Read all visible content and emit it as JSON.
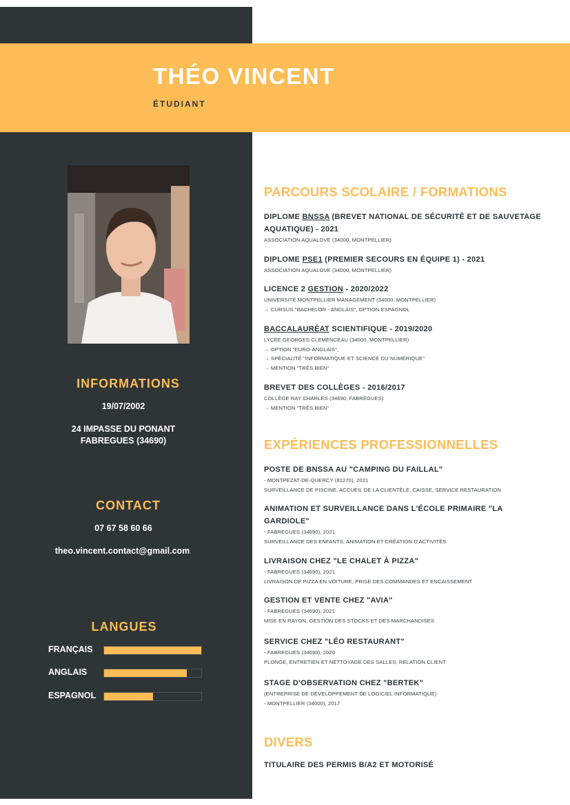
{
  "header": {
    "name": "THÉO VINCENT",
    "role": "ÉTUDIANT"
  },
  "colors": {
    "accent": "#fcbd56",
    "sidebar": "#2f3437",
    "text": "#2d3235"
  },
  "photo": {
    "alt": "portrait-photo"
  },
  "informations": {
    "title": "INFORMATIONS",
    "birthdate": "19/07/2002",
    "address_line1": "24 IMPASSE DU PONANT",
    "address_line2": "FABREGUES (34690)"
  },
  "contact": {
    "title": "CONTACT",
    "phone": "07 67 58 60 66",
    "email": "theo.vincent.contact@gmail.com"
  },
  "langues": {
    "title": "LANGUES",
    "items": [
      {
        "label": "FRANÇAIS",
        "level": 1.0
      },
      {
        "label": "ANGLAIS",
        "level": 0.85
      },
      {
        "label": "ESPAGNOL",
        "level": 0.5
      }
    ]
  },
  "formations": {
    "title": "PARCOURS SCOLAIRE / FORMATIONS",
    "items": [
      {
        "t_pre": "DIPLOME ",
        "t_u": "BNSSA",
        "t_post": " (BREVET NATIONAL DE SÉCURITÉ ET DE SAUVETAGE AQUATIQUE) - 2021",
        "lines": [
          "ASSOCIATION AQUALOVE (34000, MONTPELLIER)"
        ]
      },
      {
        "t_pre": "DIPLOME ",
        "t_u": "PSE1",
        "t_post": " (PREMIER SECOURS EN ÉQUIPE 1) - 2021",
        "lines": [
          "ASSOCIATION AQUALOVE (34000, MONTPELLIER)"
        ]
      },
      {
        "t_pre": "LICENCE 2 ",
        "t_u": "GESTION",
        "t_post": " - 2020/2022",
        "lines": [
          "UNIVERSITÉ MONTPELLIER MANAGEMENT (34000, MONTPELLIER)",
          " → CURSUS \"BACHELOR - ANGLAIS\", OPTION ESPAGNOL"
        ]
      },
      {
        "t_pre": "",
        "t_u": "BACCALAURÉAT",
        "t_post": " SCIENTIFIQUE - 2019/2020",
        "lines": [
          "LYCÉE GEORGES CLEMENCEAU (34000, MONTPELLIER)",
          " → OPTION \"EURO-ANGLAIS\",",
          " → SPÉCIALITÉ \"INFORMATIQUE ET SCIENCE DU NUMÉRIQUE\"",
          " → MENTION \"TRÈS BIEN\""
        ]
      },
      {
        "t_pre": " BREVET DES COLLÈGES - 2016/2017",
        "t_u": "",
        "t_post": "",
        "lines": [
          "COLLÈGE RAY CHARLES (34690, FABRÈGUES)",
          " → MENTION \"TRÈS BIEN\""
        ]
      }
    ]
  },
  "experiences": {
    "title": "EXPÉRIENCES PROFESSIONNELLES",
    "items": [
      {
        "title": "POSTE DE BNSSA AU \"CAMPING DU FAILLAL\"",
        "lines": [
          "- MONTPEZAT-DE-QUERCY (82270), 2021",
          "SURVEILLANCE DE PISCINE, ACCUEIL DE LA CLIENTÈLE, CAISSE, SERVICE RESTAURATION"
        ]
      },
      {
        "title": "ANIMATION ET SURVEILLANCE DANS L'ÉCOLE PRIMAIRE \"LA GARDIOLE\"",
        "lines": [
          "- FABREGUES (34690), 2021",
          "SURVEILLANCE DES ENFANTS, ANIMATION ET CRÉATION D'ACTIVITÉS"
        ]
      },
      {
        "title": "LIVRAISON CHEZ \"LE CHALET À PIZZA\"",
        "lines": [
          "- FABREGUES (34690), 2021",
          "LIVRAISON DE PIZZA EN VOITURE, PRISE DES COMMANDES ET ENCAISSEMENT"
        ]
      },
      {
        "title": "GESTION ET VENTE CHEZ \"AVIA\"",
        "lines": [
          "- FABREGUES (34690), 2021",
          "MISE EN RAYON, GESTION DES STOCKS ET DES MARCHANDISES"
        ]
      },
      {
        "title": "SERVICE CHEZ \"LÉO RESTAURANT\"",
        "lines": [
          "- FABREGUES (34690), 2020",
          "PLONGE, ENTRETIEN ET NETTOYAGE DES SALLES, RELATION CLIENT"
        ]
      },
      {
        "title": "STAGE D'OBSERVATION CHEZ \"BERTEK\"",
        "lines": [
          "(ENTREPRISE DE DÉVELOPPEMENT DE LOGICIEL INFORMATIQUE)",
          " - MONTPELLIER (34000), 2017"
        ]
      }
    ]
  },
  "divers": {
    "title": "DIVERS",
    "text": "TITULAIRE DES PERMIS B/A2 ET MOTORISÉ"
  }
}
